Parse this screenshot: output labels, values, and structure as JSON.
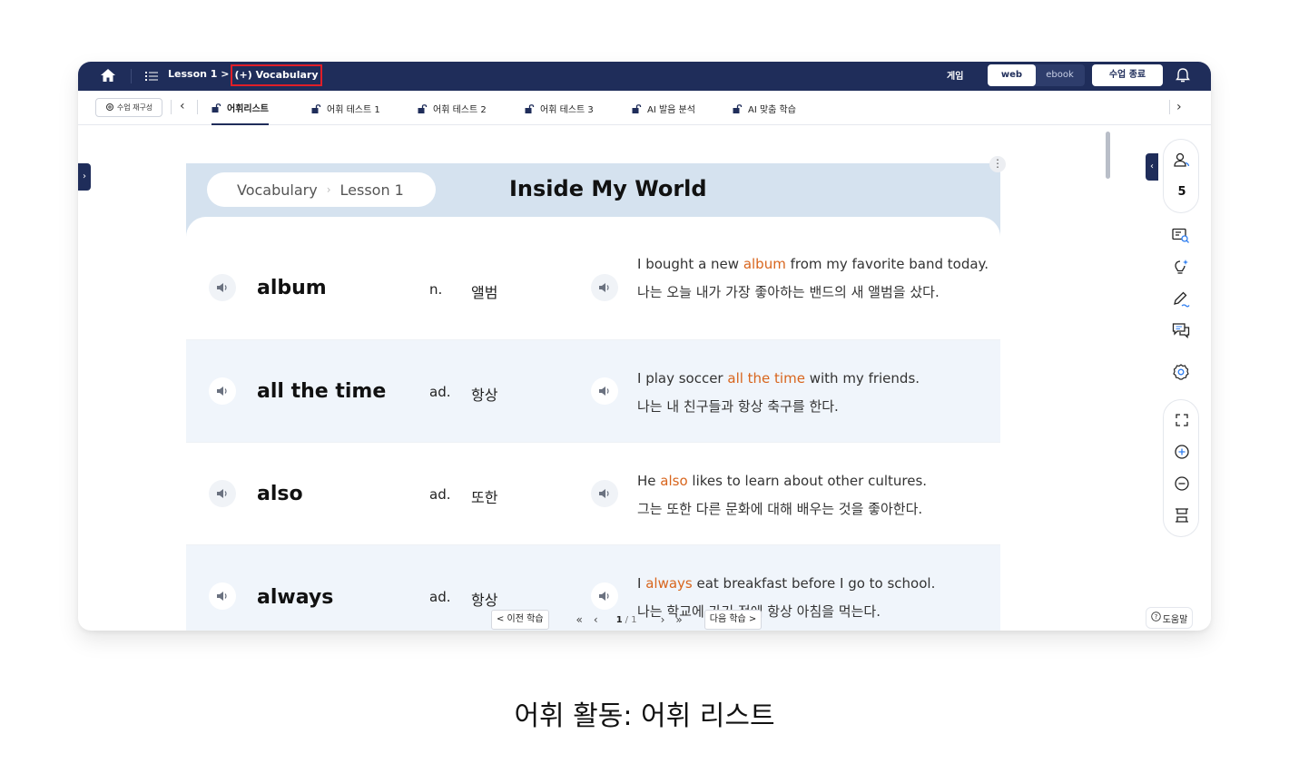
{
  "topbar": {
    "breadcrumb_prefix": "Lesson 1 >",
    "breadcrumb_current": "(+) Vocabulary",
    "game_label": "게임",
    "view_web": "web",
    "view_ebook": "ebook",
    "end_class": "수업 종료",
    "icons": [
      "home-icon",
      "menu-list-icon",
      "bell-icon"
    ]
  },
  "tabbar": {
    "rebuild_label": "수업 재구성",
    "tabs": [
      {
        "label": "어휘리스트",
        "active": true
      },
      {
        "label": "어휘 테스트 1",
        "active": false
      },
      {
        "label": "어휘 테스트 2",
        "active": false
      },
      {
        "label": "어휘 테스트 3",
        "active": false
      },
      {
        "label": "AI 발음 분석",
        "active": false
      },
      {
        "label": "AI 맞춤 학습",
        "active": false
      }
    ]
  },
  "header": {
    "crumb_first": "Vocabulary",
    "crumb_second": "Lesson 1",
    "title": "Inside My World"
  },
  "vocab": [
    {
      "word": "album",
      "pos": "n.",
      "meaning": "앨범",
      "en_pre": "I bought a new ",
      "en_hl": "album",
      "en_post": " from my favorite band today.",
      "ko": "나는 오늘 내가 가장 좋아하는 밴드의 새 앨범을 샀다."
    },
    {
      "word": "all the time",
      "pos": "ad.",
      "meaning": "항상",
      "en_pre": "I play soccer ",
      "en_hl": "all the time",
      "en_post": " with my friends.",
      "ko": "나는 내 친구들과 항상 축구를 한다."
    },
    {
      "word": "also",
      "pos": "ad.",
      "meaning": "또한",
      "en_pre": "He ",
      "en_hl": "also",
      "en_post": " likes to learn about other cultures.",
      "ko": "그는 또한 다른 문화에 대해 배우는 것을 좋아한다."
    },
    {
      "word": "always",
      "pos": "ad.",
      "meaning": "항상",
      "en_pre": "I ",
      "en_hl": "always",
      "en_post": " eat breakfast before I go to school.",
      "ko": "나는 학교에 가기 전에 항상 아침을 먹는다."
    }
  ],
  "pager": {
    "prev_label": "< 이전 학습",
    "first": "«",
    "prev": "‹",
    "current": "1",
    "total": "/ 1",
    "next": "›",
    "last": "»",
    "next_label": "다음 학습 >"
  },
  "side": {
    "participants": "5",
    "help_label": "도움말",
    "icons": [
      "people-icon",
      "screen-search-icon",
      "lightbulb-icon",
      "pen-icon",
      "chat-icon",
      "settings-icon",
      "fullscreen-icon",
      "zoom-in-icon",
      "zoom-out-icon",
      "fit-height-icon"
    ]
  },
  "caption": "어휘 활동: 어휘 리스트",
  "colors": {
    "navy": "#1f2d5a",
    "highlight": "#d8651d",
    "header_bg": "#d5e2ef",
    "red_box": "#e01e28"
  }
}
